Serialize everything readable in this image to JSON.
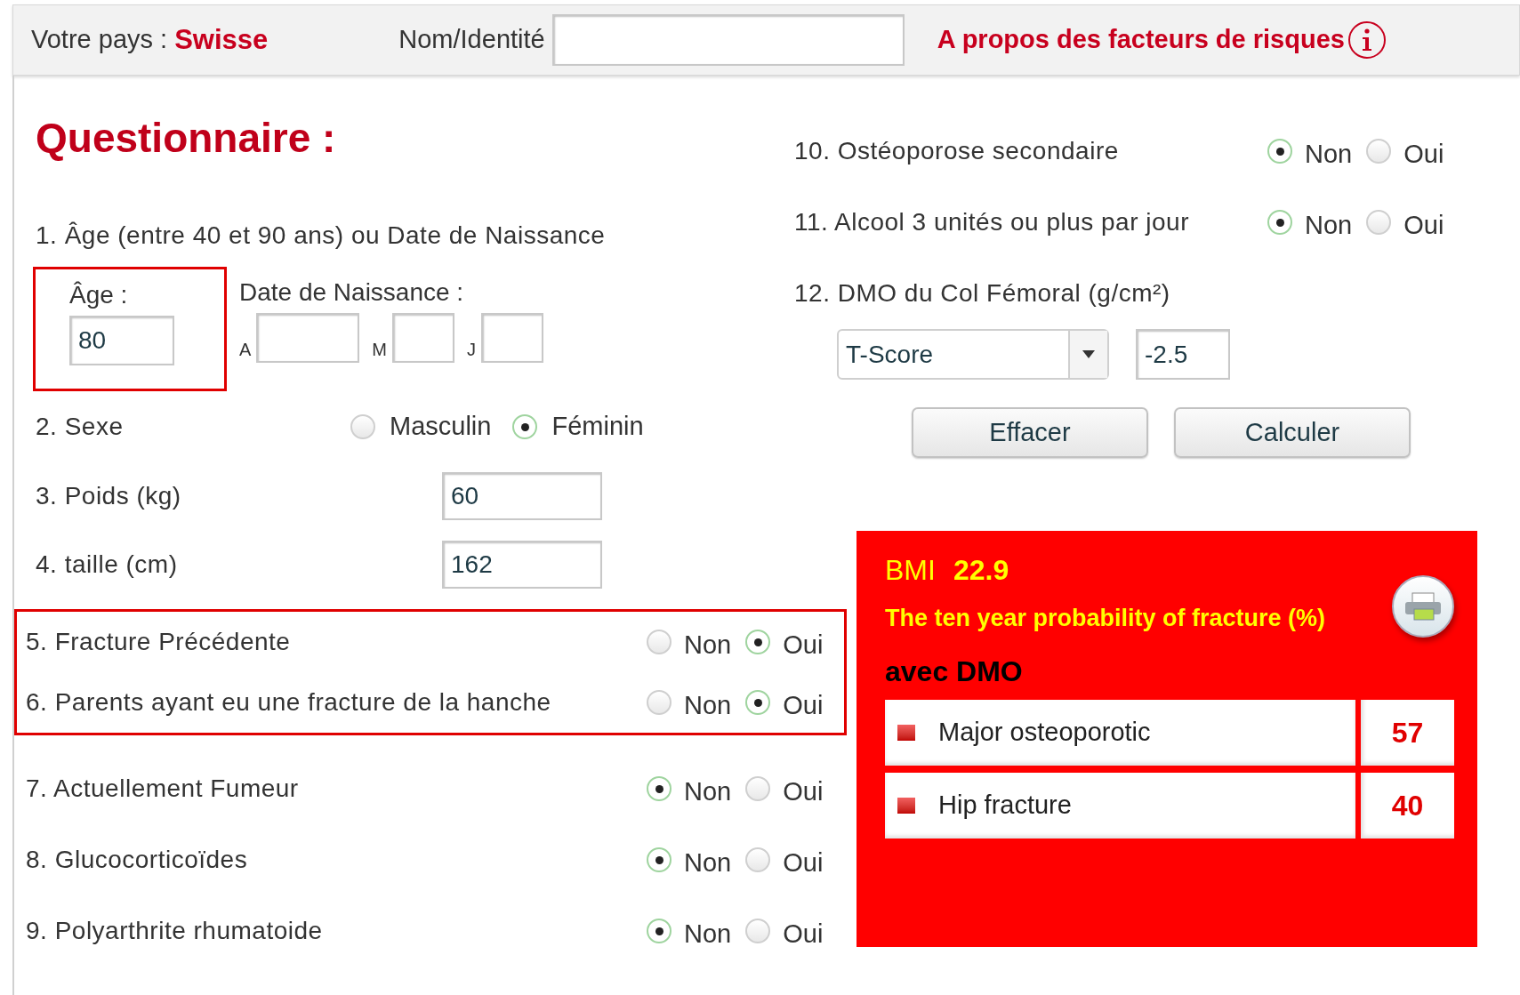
{
  "header": {
    "country_label": "Votre pays :",
    "country": "Swisse",
    "name_label": "Nom/Identité",
    "about_link": "A propos des facteurs de risques"
  },
  "title": "Questionnaire :",
  "q1": {
    "label": "1. Âge (entre 40 et 90 ans) ou Date de Naissance",
    "age": {
      "label": "Âge :",
      "value": "80",
      "highlighted": true
    },
    "birth": {
      "label": "Date de Naissance :",
      "fields": [
        {
          "label": "A"
        },
        {
          "label": "M"
        },
        {
          "label": "J"
        }
      ]
    }
  },
  "sex": {
    "label": "2. Sexe",
    "options": [
      {
        "label": "Masculin",
        "selected": false
      },
      {
        "label": "Féminin",
        "selected": true
      }
    ]
  },
  "weight": {
    "label": "3. Poids (kg)",
    "value": "60"
  },
  "height": {
    "label": "4. taille (cm)",
    "value": "162"
  },
  "left_risk_factors": [
    {
      "label": "5. Fracture Précédente",
      "highlighted": true,
      "options": [
        {
          "label": "Non",
          "selected": false
        },
        {
          "label": "Oui",
          "selected": true
        }
      ]
    },
    {
      "label": "6. Parents ayant eu une fracture de la hanche",
      "highlighted": true,
      "options": [
        {
          "label": "Non",
          "selected": false
        },
        {
          "label": "Oui",
          "selected": true
        }
      ]
    },
    {
      "label": "7. Actuellement Fumeur",
      "highlighted": false,
      "options": [
        {
          "label": "Non",
          "selected": true
        },
        {
          "label": "Oui",
          "selected": false
        }
      ]
    },
    {
      "label": "8. Glucocorticoïdes",
      "highlighted": false,
      "options": [
        {
          "label": "Non",
          "selected": true
        },
        {
          "label": "Oui",
          "selected": false
        }
      ]
    },
    {
      "label": "9. Polyarthrite rhumatoide",
      "highlighted": false,
      "options": [
        {
          "label": "Non",
          "selected": true
        },
        {
          "label": "Oui",
          "selected": false
        }
      ]
    }
  ],
  "right_risk_factors": [
    {
      "label": "10. Ostéoporose secondaire",
      "options": [
        {
          "label": "Non",
          "selected": true
        },
        {
          "label": "Oui",
          "selected": false
        }
      ]
    },
    {
      "label": "11. Alcool 3 unités ou plus par jour",
      "options": [
        {
          "label": "Non",
          "selected": true
        },
        {
          "label": "Oui",
          "selected": false
        }
      ]
    }
  ],
  "bmd": {
    "label": "12. DMO du Col Fémoral (g/cm²)",
    "type_select": "T-Score",
    "value": "-2.5"
  },
  "buttons": [
    "Effacer",
    "Calculer"
  ],
  "results": {
    "bmi_label": "BMI",
    "bmi": "22.9",
    "subtitle": "The ten year probability of fracture (%)",
    "section": "avec DMO",
    "rows": [
      {
        "label": "Major osteoporotic",
        "value": "57"
      },
      {
        "label": "Hip fracture",
        "value": "40"
      }
    ]
  }
}
